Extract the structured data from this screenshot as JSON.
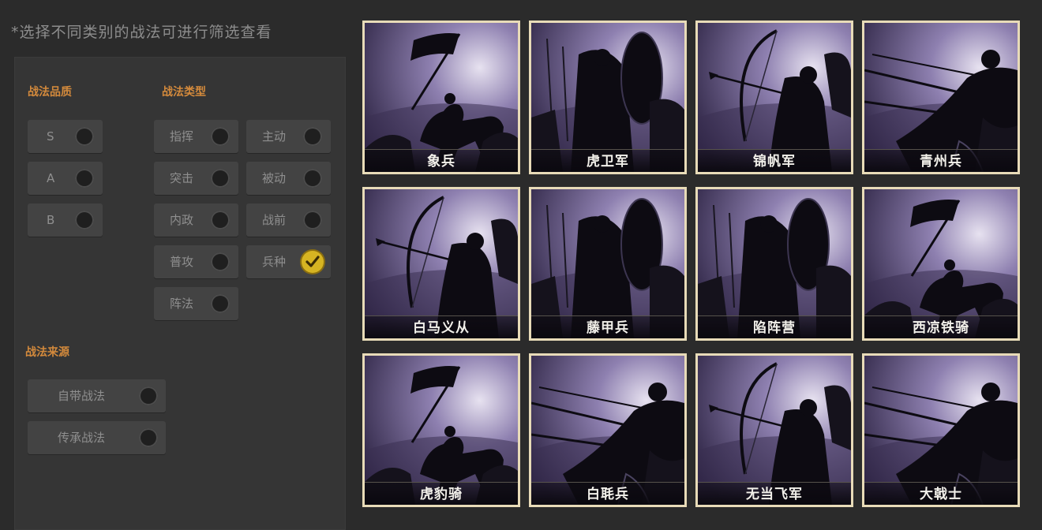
{
  "hint": "*选择不同类别的战法可进行筛选查看",
  "sections": {
    "quality_title": "战法品质",
    "type_title": "战法类型",
    "source_title": "战法来源"
  },
  "quality_options": [
    {
      "label": "S",
      "checked": false
    },
    {
      "label": "A",
      "checked": false
    },
    {
      "label": "B",
      "checked": false
    }
  ],
  "type_options": [
    {
      "label": "指挥",
      "checked": false
    },
    {
      "label": "主动",
      "checked": false
    },
    {
      "label": "突击",
      "checked": false
    },
    {
      "label": "被动",
      "checked": false
    },
    {
      "label": "内政",
      "checked": false
    },
    {
      "label": "战前",
      "checked": false
    },
    {
      "label": "普攻",
      "checked": false
    },
    {
      "label": "兵种",
      "checked": true
    },
    {
      "label": "阵法",
      "checked": false
    }
  ],
  "source_options": [
    {
      "label": "自带战法",
      "checked": false
    },
    {
      "label": "传承战法",
      "checked": false
    }
  ],
  "cards": [
    {
      "name": "象兵",
      "art": "flag-cavalry"
    },
    {
      "name": "虎卫军",
      "art": "shield-soldier"
    },
    {
      "name": "锦帆军",
      "art": "archer"
    },
    {
      "name": "青州兵",
      "art": "spear-charge"
    },
    {
      "name": "白马义从",
      "art": "archer"
    },
    {
      "name": "藤甲兵",
      "art": "shield-soldier"
    },
    {
      "name": "陷阵营",
      "art": "shield-soldier"
    },
    {
      "name": "西凉铁骑",
      "art": "flag-cavalry"
    },
    {
      "name": "虎豹骑",
      "art": "flag-cavalry"
    },
    {
      "name": "白毦兵",
      "art": "spear-charge"
    },
    {
      "name": "无当飞军",
      "art": "archer"
    },
    {
      "name": "大戟士",
      "art": "spear-charge"
    }
  ],
  "colors": {
    "accent_title": "#d48a3c",
    "check": "#d6b422",
    "card_border": "#e8dbb8"
  }
}
